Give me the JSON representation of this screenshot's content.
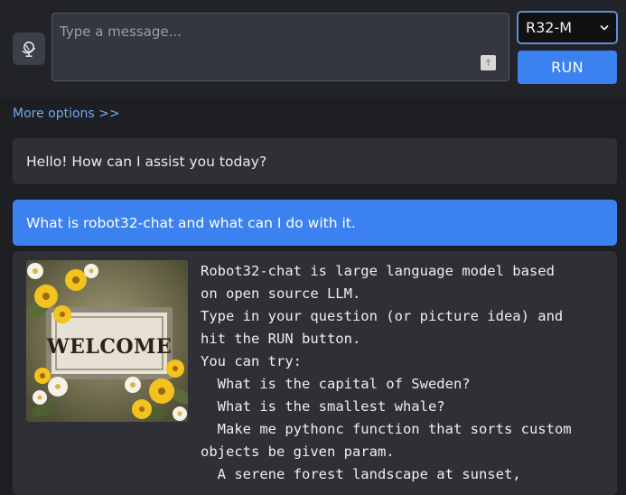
{
  "input": {
    "placeholder": "Type a message..."
  },
  "model_select": {
    "selected": "R32-M"
  },
  "run_button": {
    "label": "RUN"
  },
  "more_options_link": "More options >>",
  "messages": [
    {
      "role": "bot",
      "text": "Hello! How can I assist you today?"
    },
    {
      "role": "user",
      "text": "What is robot32-chat and what can I do with it."
    }
  ],
  "response": {
    "image_text": "WELCOME",
    "lines": [
      "Robot32-chat is large language model based",
      "on open source LLM.",
      "Type in your question (or picture idea) and",
      "hit the RUN button.",
      "You can try:",
      "  What is the capital of Sweden?",
      "  What is the smallest whale?",
      "  Make me pythonc function that sorts custom",
      "objects be given param.",
      "  A serene forest landscape at sunset,"
    ]
  },
  "colors": {
    "accent": "#3b82f0",
    "link": "#6fa8f0",
    "background": "#1e1f23",
    "bubble": "#2e3036"
  },
  "icons": {
    "globe": "globe-icon",
    "upload": "upload-icon",
    "chevron": "chevron-down-icon"
  }
}
